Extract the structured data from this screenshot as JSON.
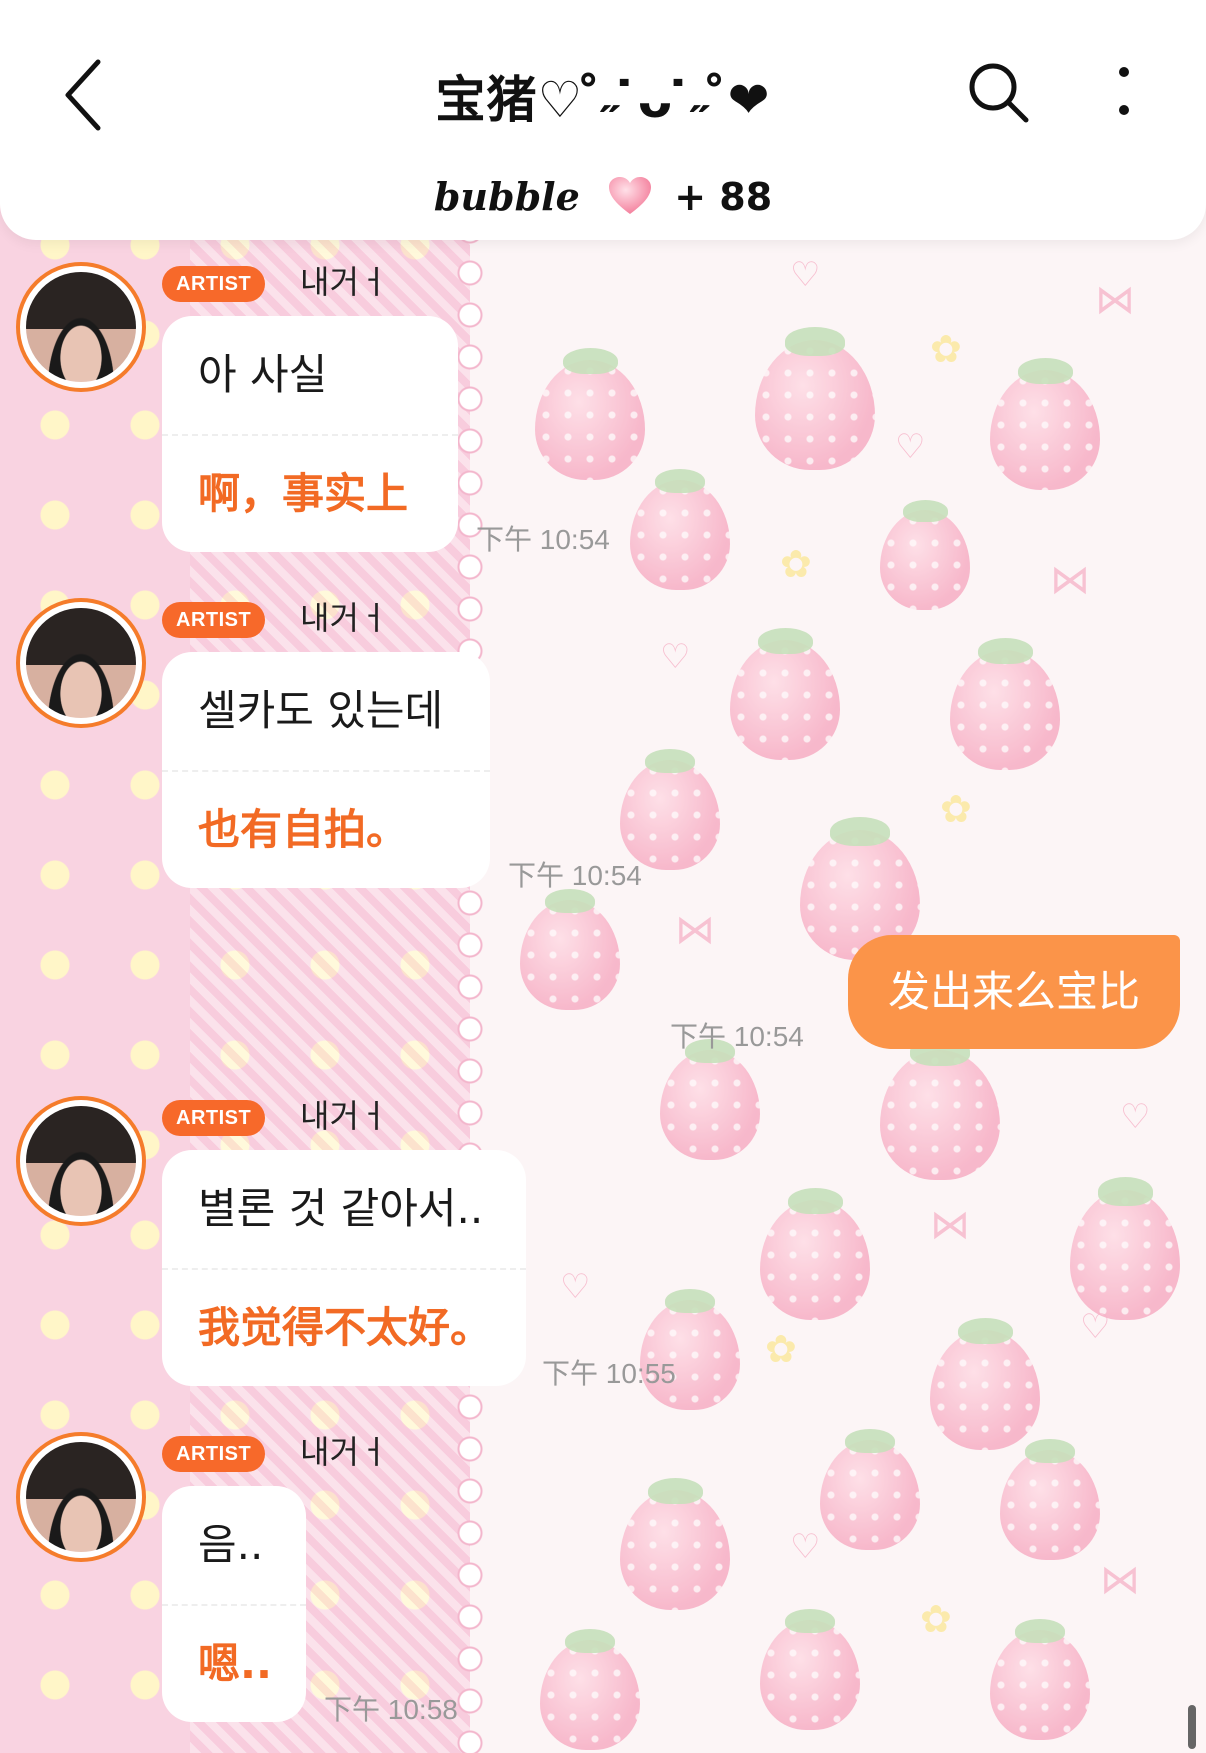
{
  "header": {
    "title": "宝猪♡ ̊˶ ̇ᴗ ̇˶ ̊❤︎",
    "subtitle_word": "bubble",
    "subtitle_count": "+ 88"
  },
  "messages": [
    {
      "badge": "ARTIST",
      "sender": "내거ㅓ",
      "korean": "아 사실",
      "chinese": "啊，事实上",
      "time": "下午 10:54"
    },
    {
      "badge": "ARTIST",
      "sender": "내거ㅓ",
      "korean": "셀카도 있는데",
      "chinese": "也有自拍。",
      "time": "下午 10:54"
    },
    {
      "badge": "ARTIST",
      "sender": "내거ㅓ",
      "korean": "별론 것 같아서..",
      "chinese": "我觉得不太好。",
      "time": "下午 10:55"
    },
    {
      "badge": "ARTIST",
      "sender": "내거ㅓ",
      "korean": "음..",
      "chinese": "嗯..",
      "time": "下午 10:58"
    }
  ],
  "sent_message": {
    "text": "发出来么宝比",
    "time": "下午 10:54"
  },
  "colors": {
    "accent": "#f7692a",
    "sent_bubble": "#fb9449",
    "translation_text": "#f26a24",
    "background_pink": "#f9d3e1"
  },
  "icons": [
    "back-icon",
    "search-icon",
    "more-vertical-icon",
    "pink-heart-icon"
  ]
}
